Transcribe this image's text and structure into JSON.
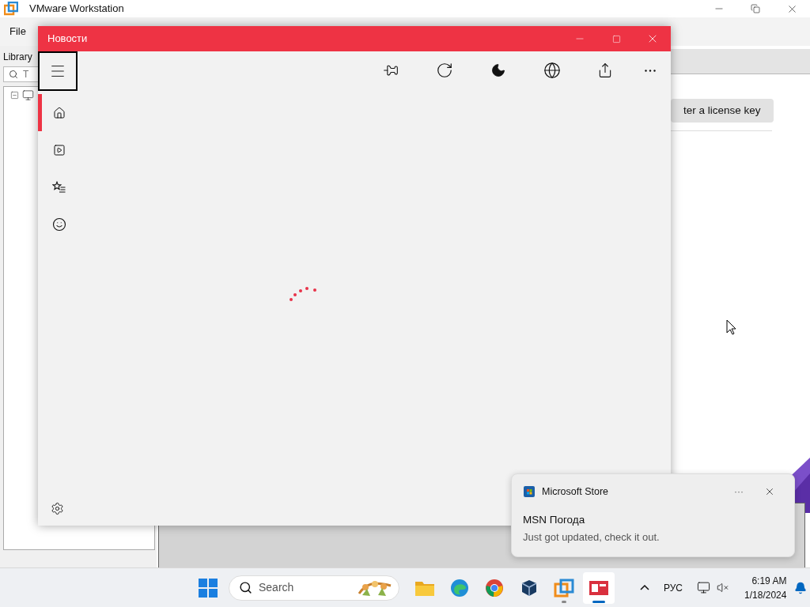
{
  "vmware_window": {
    "title": "VMware Workstation",
    "menu": [
      "File"
    ],
    "library": {
      "label": "Library",
      "search_placeholder": "T"
    },
    "license_button": "ter a license key"
  },
  "news_window": {
    "title": "Новости",
    "nav_items": [
      {
        "selected": true
      },
      {
        "selected": false
      },
      {
        "selected": false
      },
      {
        "selected": false
      }
    ]
  },
  "notification": {
    "app": "Microsoft Store",
    "more": "···",
    "title": "MSN Погода",
    "body": "Just got updated, check it out."
  },
  "taskbar": {
    "search_placeholder": "Search",
    "apps": [
      {
        "selected": false,
        "open": false
      },
      {
        "selected": false,
        "open": false
      },
      {
        "selected": false,
        "open": false
      },
      {
        "selected": false,
        "open": false
      },
      {
        "selected": false,
        "open": true
      },
      {
        "selected": true,
        "open": true
      }
    ],
    "language": "РУС",
    "time": "6:19 AM",
    "date": "1/18/2024"
  }
}
